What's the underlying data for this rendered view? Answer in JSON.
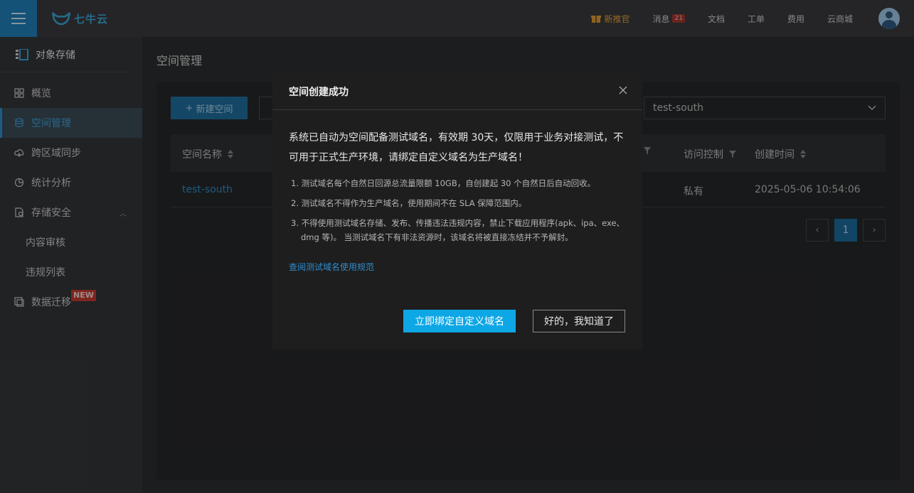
{
  "header": {
    "logo_text": "七牛云",
    "nav": [
      {
        "label": "新推官",
        "icon": "gift-icon"
      },
      {
        "label": "消息",
        "badge": "21"
      },
      {
        "label": "文档"
      },
      {
        "label": "工单"
      },
      {
        "label": "费用"
      },
      {
        "label": "云商城"
      }
    ]
  },
  "sidebar": {
    "section_title": "对象存储",
    "items": [
      {
        "label": "概览",
        "icon": "grid-icon"
      },
      {
        "label": "空间管理",
        "icon": "database-icon",
        "active": true
      },
      {
        "label": "跨区域同步",
        "icon": "cloud-sync-icon"
      },
      {
        "label": "统计分析",
        "icon": "pie-chart-icon"
      },
      {
        "label": "存储安全",
        "icon": "shield-doc-icon",
        "expanded": true
      },
      {
        "label": "内容审核",
        "sub": true
      },
      {
        "label": "违规列表",
        "sub": true
      },
      {
        "label": "数据迁移",
        "icon": "migrate-icon",
        "badge": "NEW"
      }
    ]
  },
  "main": {
    "title": "空间管理",
    "new_bucket_label": "新建空间",
    "bucket_select_value": "test-south",
    "table": {
      "columns": [
        "空间名称",
        "访问控制",
        "创建时间"
      ],
      "rows": [
        {
          "name": "test-south",
          "access": "私有",
          "created": "2025-05-06 10:54:06"
        }
      ]
    },
    "pagination": {
      "current": "1"
    }
  },
  "modal": {
    "title": "空间创建成功",
    "lead": "系统已自动为空间配备测试域名，有效期 30天，仅限用于业务对接测试，不可用于正式生产环境，请绑定自定义域名为生产域名！",
    "rules": [
      "1. 测试域名每个自然日回源总流量限额  10GB，自创建起  30  个自然日后自动回收。",
      "2. 测试域名不得作为生产域名，使用期间不在 SLA 保障范围内。",
      "3. 不得使用测试域名存储、发布、传播违法违规内容，禁止下载应用程序(apk、ipa、exe、dmg 等)。 当测试域名下有非法资源时，该域名将被直接冻结并不予解封。"
    ],
    "link": "查阅测试域名使用规范",
    "primary_button": "立即绑定自定义域名",
    "secondary_button": "好的，我知道了"
  }
}
